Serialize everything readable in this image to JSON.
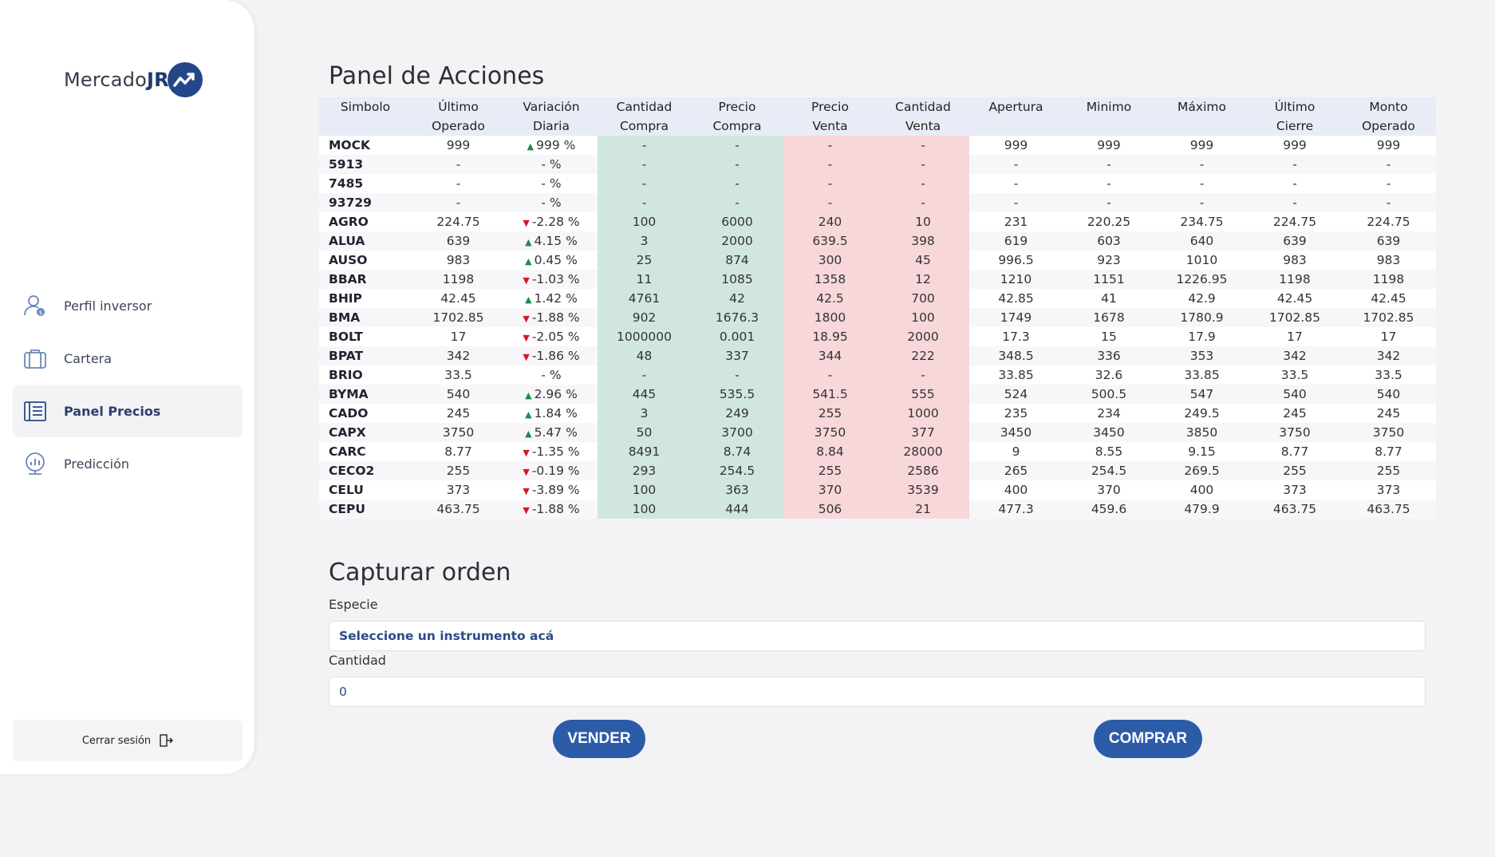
{
  "brand": {
    "text_a": "Mercado",
    "text_b": "JR"
  },
  "sidebar": {
    "items": [
      {
        "label": "Perfil inversor",
        "icon": "user-profile-icon"
      },
      {
        "label": "Cartera",
        "icon": "briefcase-icon"
      },
      {
        "label": "Panel Precios",
        "icon": "price-panel-icon",
        "active": true
      },
      {
        "label": "Predicción",
        "icon": "prediction-icon"
      }
    ],
    "logout_label": "Cerrar sesión"
  },
  "panel": {
    "title": "Panel de Acciones",
    "headers": [
      [
        "Simbolo",
        ""
      ],
      [
        "Último",
        "Operado"
      ],
      [
        "Variación",
        "Diaria"
      ],
      [
        "Cantidad",
        "Compra"
      ],
      [
        "Precio",
        "Compra"
      ],
      [
        "Precio",
        "Venta"
      ],
      [
        "Cantidad",
        "Venta"
      ],
      [
        "Apertura",
        ""
      ],
      [
        "Minimo",
        ""
      ],
      [
        "Máximo",
        ""
      ],
      [
        "Último",
        "Cierre"
      ],
      [
        "Monto",
        "Operado"
      ]
    ],
    "rows": [
      [
        "MOCK",
        "999",
        "up",
        "999 %",
        "-",
        "-",
        "-",
        "-",
        "999",
        "999",
        "999",
        "999",
        "999"
      ],
      [
        "5913",
        "-",
        "",
        "- %",
        "-",
        "-",
        "-",
        "-",
        "-",
        "-",
        "-",
        "-",
        "-"
      ],
      [
        "7485",
        "-",
        "",
        "- %",
        "-",
        "-",
        "-",
        "-",
        "-",
        "-",
        "-",
        "-",
        "-"
      ],
      [
        "93729",
        "-",
        "",
        "- %",
        "-",
        "-",
        "-",
        "-",
        "-",
        "-",
        "-",
        "-",
        "-"
      ],
      [
        "AGRO",
        "224.75",
        "down",
        "-2.28 %",
        "100",
        "6000",
        "240",
        "10",
        "231",
        "220.25",
        "234.75",
        "224.75",
        "224.75"
      ],
      [
        "ALUA",
        "639",
        "up",
        "4.15 %",
        "3",
        "2000",
        "639.5",
        "398",
        "619",
        "603",
        "640",
        "639",
        "639"
      ],
      [
        "AUSO",
        "983",
        "up",
        "0.45 %",
        "25",
        "874",
        "300",
        "45",
        "996.5",
        "923",
        "1010",
        "983",
        "983"
      ],
      [
        "BBAR",
        "1198",
        "down",
        "-1.03 %",
        "11",
        "1085",
        "1358",
        "12",
        "1210",
        "1151",
        "1226.95",
        "1198",
        "1198"
      ],
      [
        "BHIP",
        "42.45",
        "up",
        "1.42 %",
        "4761",
        "42",
        "42.5",
        "700",
        "42.85",
        "41",
        "42.9",
        "42.45",
        "42.45"
      ],
      [
        "BMA",
        "1702.85",
        "down",
        "-1.88 %",
        "902",
        "1676.3",
        "1800",
        "100",
        "1749",
        "1678",
        "1780.9",
        "1702.85",
        "1702.85"
      ],
      [
        "BOLT",
        "17",
        "down",
        "-2.05 %",
        "1000000",
        "0.001",
        "18.95",
        "2000",
        "17.3",
        "15",
        "17.9",
        "17",
        "17"
      ],
      [
        "BPAT",
        "342",
        "down",
        "-1.86 %",
        "48",
        "337",
        "344",
        "222",
        "348.5",
        "336",
        "353",
        "342",
        "342"
      ],
      [
        "BRIO",
        "33.5",
        "",
        "- %",
        "-",
        "-",
        "-",
        "-",
        "33.85",
        "32.6",
        "33.85",
        "33.5",
        "33.5"
      ],
      [
        "BYMA",
        "540",
        "up",
        "2.96 %",
        "445",
        "535.5",
        "541.5",
        "555",
        "524",
        "500.5",
        "547",
        "540",
        "540"
      ],
      [
        "CADO",
        "245",
        "up",
        "1.84 %",
        "3",
        "249",
        "255",
        "1000",
        "235",
        "234",
        "249.5",
        "245",
        "245"
      ],
      [
        "CAPX",
        "3750",
        "up",
        "5.47 %",
        "50",
        "3700",
        "3750",
        "377",
        "3450",
        "3450",
        "3850",
        "3750",
        "3750"
      ],
      [
        "CARC",
        "8.77",
        "down",
        "-1.35 %",
        "8491",
        "8.74",
        "8.84",
        "28000",
        "9",
        "8.55",
        "9.15",
        "8.77",
        "8.77"
      ],
      [
        "CECO2",
        "255",
        "down",
        "-0.19 %",
        "293",
        "254.5",
        "255",
        "2586",
        "265",
        "254.5",
        "269.5",
        "255",
        "255"
      ],
      [
        "CELU",
        "373",
        "down",
        "-3.89 %",
        "100",
        "363",
        "370",
        "3539",
        "400",
        "370",
        "400",
        "373",
        "373"
      ],
      [
        "CEPU",
        "463.75",
        "down",
        "-1.88 %",
        "100",
        "444",
        "506",
        "21",
        "477.3",
        "459.6",
        "479.9",
        "463.75",
        "463.75"
      ]
    ]
  },
  "order": {
    "title": "Capturar orden",
    "especie_label": "Especie",
    "especie_value": "Seleccione un instrumento acá",
    "cantidad_label": "Cantidad",
    "cantidad_value": "0",
    "sell_label": "VENDER",
    "buy_label": "COMPRAR"
  },
  "colors": {
    "accent": "#2c5ca8",
    "buy_bg": "#d1e7dd",
    "sell_bg": "#f8d7da",
    "up": "#1c8a4a",
    "down": "#d11a2a"
  }
}
